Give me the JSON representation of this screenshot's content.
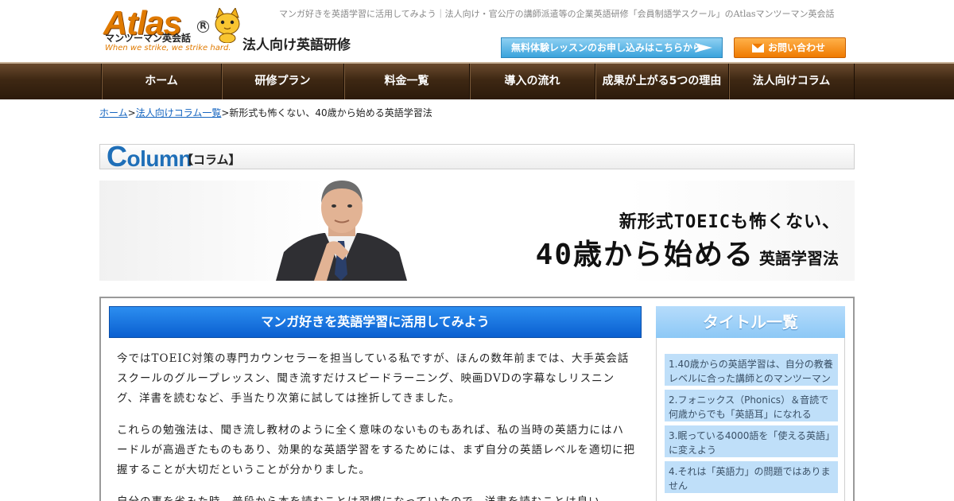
{
  "header": {
    "logo_word": "Atlas",
    "logo_registered": "R",
    "logo_sub": "マンツーマン英会話",
    "logo_tagline": "When we strike, we strike hard.",
    "site_title": "法人向け英語研修",
    "description": "マンガ好きを英語学習に活用してみよう｜法人向け・官公庁の講師派遣等の企業英語研修「会員制語学スクール」のAtlasマンツーマン英会話",
    "trial_button": "無料体験レッスンのお申し込みはこちらから",
    "contact_button": "お問い合わせ"
  },
  "nav": {
    "items": [
      "ホーム",
      "研修プラン",
      "料金一覧",
      "導入の流れ",
      "成果が上がる5つの理由",
      "法人向けコラム"
    ]
  },
  "breadcrumb": {
    "home": "ホーム",
    "sep1": ">",
    "column_list": "法人向けコラム一覧",
    "sep2": ">",
    "current": "新形式も怖くない、40歳から始める英語学習法"
  },
  "column_heading": {
    "first_letter": "C",
    "rest": "olumn",
    "jp": "【コラム】"
  },
  "banner": {
    "line1": "新形式TOEICも怖くない、",
    "line2_big": "40歳から始める",
    "line2_small": "英語学習法"
  },
  "article": {
    "title": "マンガ好きを英語学習に活用してみよう",
    "paragraphs": [
      "今ではTOEIC対策の専門カウンセラーを担当している私ですが、ほんの数年前までは、大手英会話スクールのグループレッスン、聞き流すだけスピードラーニング、映画DVDの字幕なしリスニング、洋書を読むなど、手当たり次第に試しては挫折してきました。",
      "これらの勉強法は、聞き流し教材のように全く意味のないものもあれば、私の当時の英語力にはハードルが高過ぎたものもあり、効果的な英語学習をするためには、まず自分の英語レベルを適切に把握することが大切だということが分かりました。",
      "自分の事を省みた時、普段から本を読むことは習慣になっていたので、洋書を読むことは良い"
    ]
  },
  "sidebar": {
    "heading": "タイトル一覧",
    "items": [
      "1.40歳からの英語学習は、自分の教養レベルに合った講師とのマンツーマン",
      "2.フォニックス（Phonics）＆音読で何歳からでも「英語耳」になれる",
      "3.眠っている4000語を「使える英語」に変えよう",
      "4.それは「英語力」の問題ではありません"
    ]
  }
}
